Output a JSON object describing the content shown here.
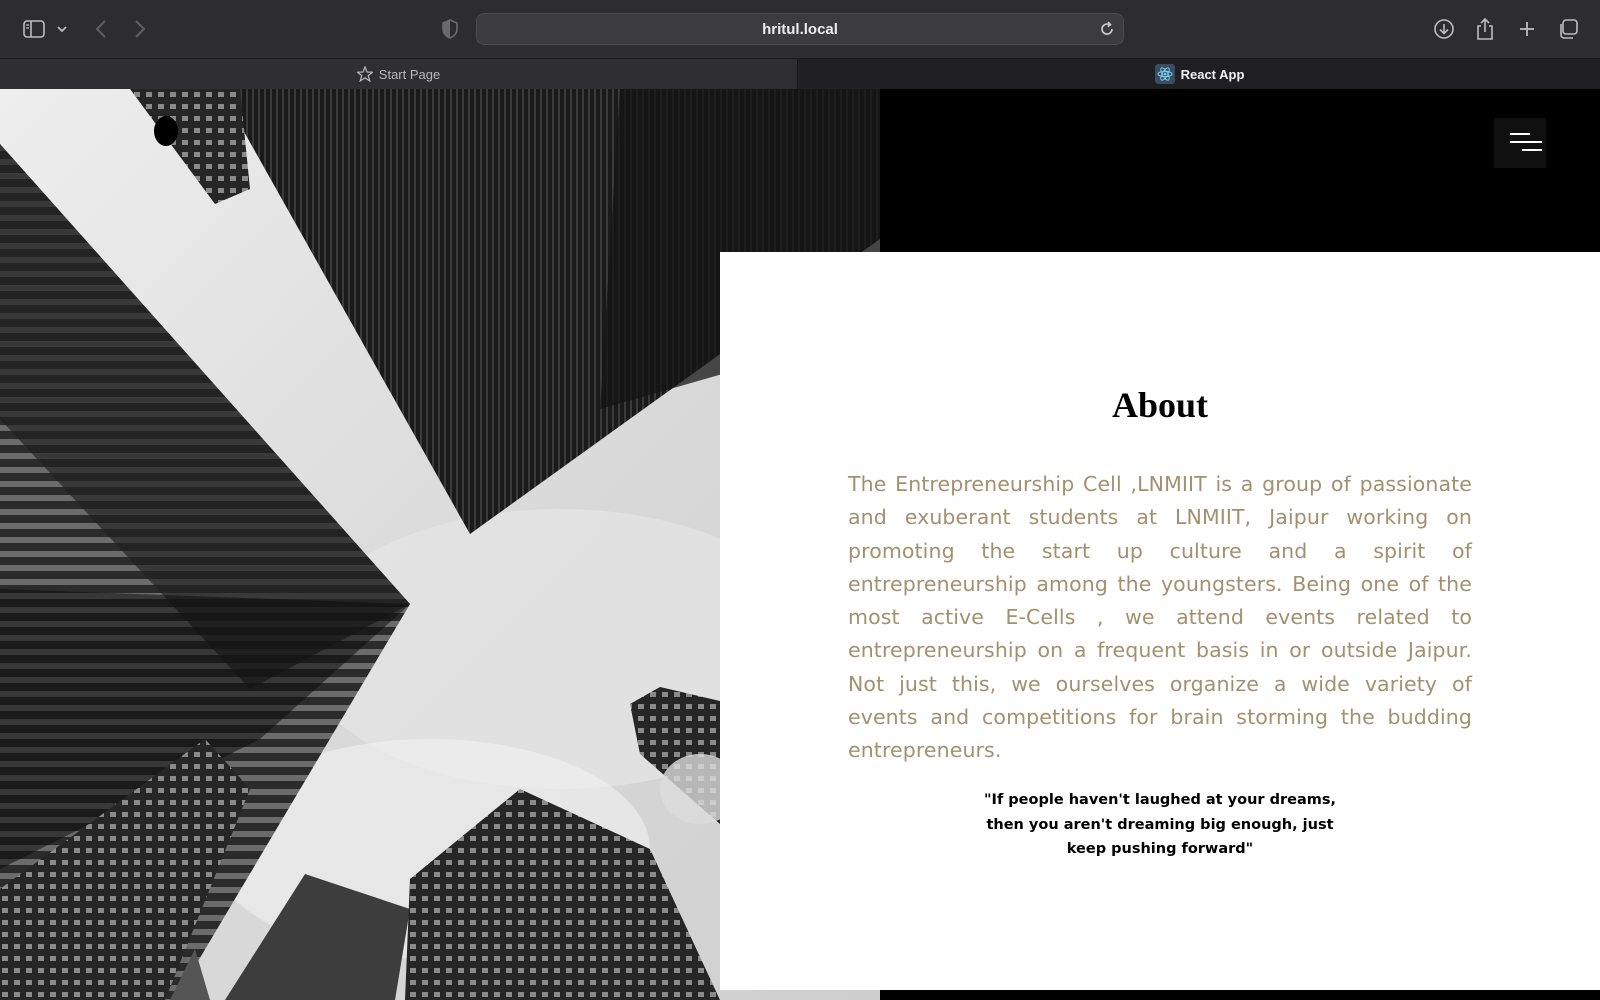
{
  "browser": {
    "url": "hritul.local",
    "tabs": [
      {
        "label": "Start Page",
        "icon": "star-icon",
        "active": false
      },
      {
        "label": "React App",
        "icon": "react-icon",
        "active": true
      }
    ],
    "toolbar_icons": [
      "sidebar-icon",
      "chevron-down-icon",
      "back-icon",
      "forward-icon",
      "shield-icon",
      "reload-icon",
      "download-icon",
      "share-icon",
      "plus-icon",
      "tabs-overview-icon"
    ]
  },
  "page": {
    "menu_icon": "hamburger-menu-icon",
    "hero_image": "grayscale-skyscrapers-looking-up",
    "about": {
      "title": "About",
      "body": "The Entrepreneurship Cell ,LNMIIT is a group of passionate and exuberant students at LNMIIT, Jaipur working on promoting the start up culture and a spirit of entrepreneurship among the youngsters. Being one of the most active E-Cells , we attend events related to entrepreneurship on a frequent basis in or outside Jaipur. Not just this, we ourselves organize a wide variety of events and competitions for brain storming the budding entrepreneurs.",
      "quote": "\"If people haven't laughed at your dreams, then you aren't dreaming big enough, just keep pushing forward\""
    },
    "colors": {
      "body_text": "#a3906f",
      "background": "#000000",
      "card": "#ffffff"
    }
  }
}
